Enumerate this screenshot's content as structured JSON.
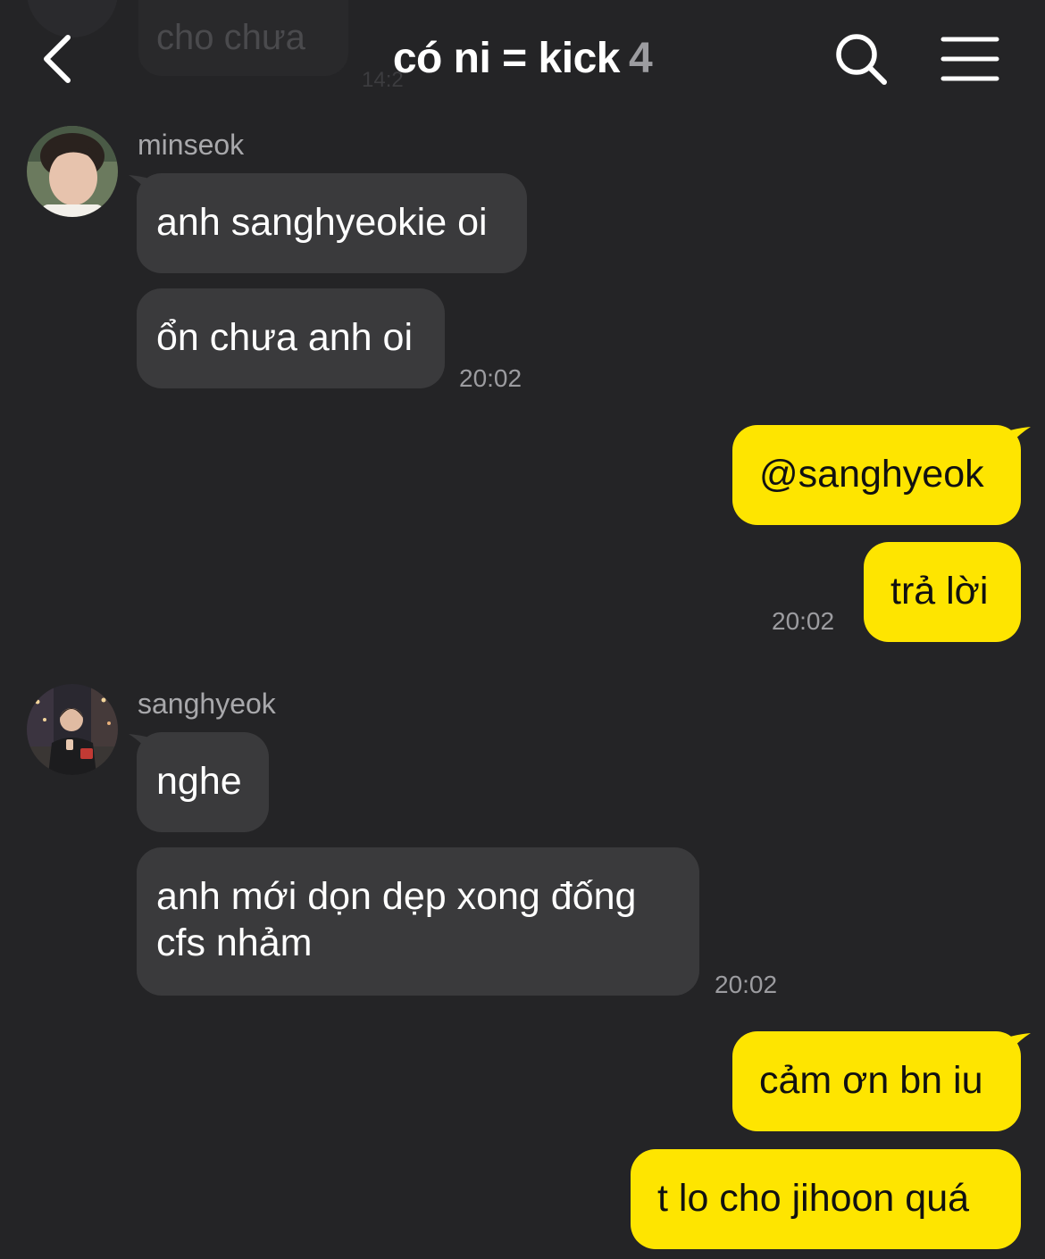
{
  "colors": {
    "background": "#242426",
    "incoming_bubble": "#3a3a3c",
    "outgoing_bubble": "#fee500",
    "muted_text": "#9c9ca0"
  },
  "header": {
    "title": "có ni = kick",
    "member_count": "4",
    "back_icon": "chevron-left-icon",
    "search_icon": "search-icon",
    "menu_icon": "hamburger-menu-icon"
  },
  "previous_message": {
    "text": "cho chưa",
    "time": "14:2"
  },
  "messages": {
    "group1": {
      "sender": "minseok",
      "bubbles": [
        "anh sanghyeokie oi",
        "ổn chưa anh oi"
      ],
      "time": "20:02"
    },
    "group2": {
      "bubbles": [
        "@sanghyeok",
        "trả lời"
      ],
      "time": "20:02"
    },
    "group3": {
      "sender": "sanghyeok",
      "bubbles": [
        "nghe",
        "anh mới dọn dẹp xong đống",
        "cfs nhảm"
      ],
      "time": "20:02"
    },
    "group4": {
      "bubbles": [
        "cảm ơn bn iu",
        "t lo cho jihoon quá"
      ]
    }
  }
}
